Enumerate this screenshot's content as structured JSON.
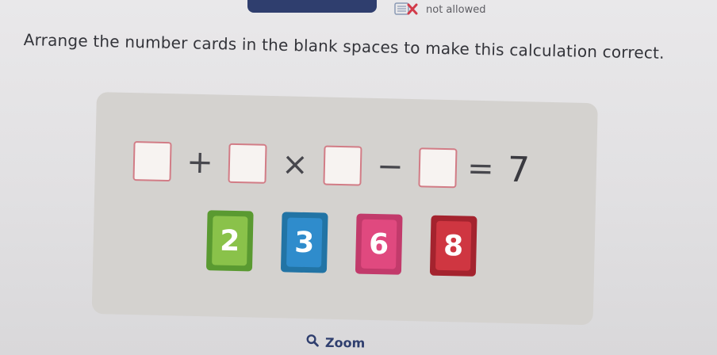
{
  "status": {
    "icon": "calculator-crossed-icon",
    "text": "not allowed"
  },
  "instruction": "Arrange the number cards in the blank spaces to make this calculation correct.",
  "equation": {
    "operators": [
      "+",
      "×",
      "−",
      "="
    ],
    "result": "7"
  },
  "cards": [
    {
      "value": "2",
      "color": "#5a9a31",
      "inner": "#8ac24a"
    },
    {
      "value": "3",
      "color": "#2274a5",
      "inner": "#2f8ccc"
    },
    {
      "value": "6",
      "color": "#c23a6b",
      "inner": "#e0497f"
    },
    {
      "value": "8",
      "color": "#a4232e",
      "inner": "#cf3641"
    }
  ],
  "zoom": {
    "label": "Zoom",
    "icon": "magnifier-icon"
  },
  "colors": {
    "accent": "#2f3e6e",
    "blank_border": "#d27c86"
  }
}
